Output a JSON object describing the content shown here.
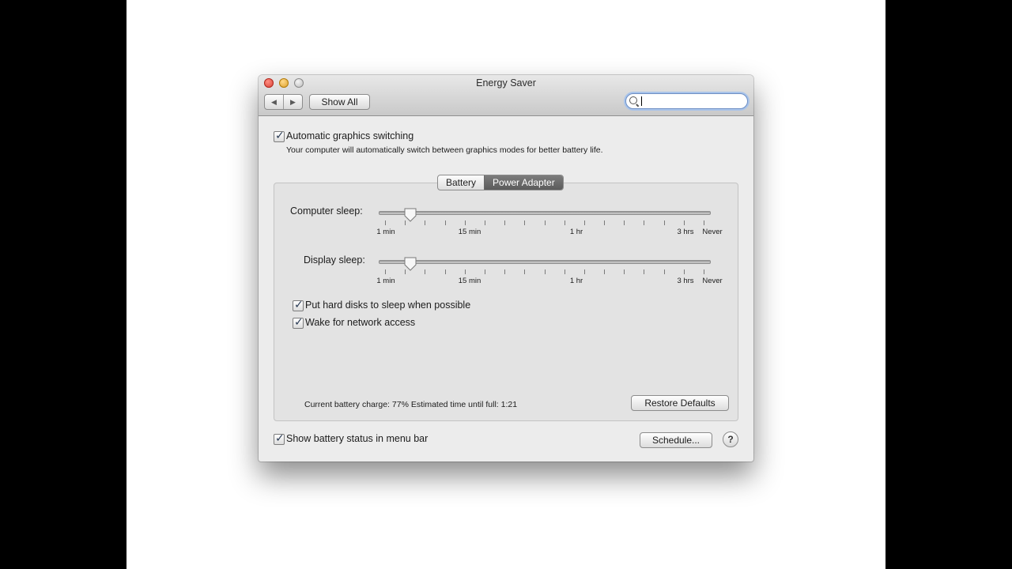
{
  "window": {
    "title": "Energy Saver"
  },
  "toolbar": {
    "back_glyph": "◀",
    "forward_glyph": "▶",
    "show_all_label": "Show All",
    "search_value": "",
    "search_icon": "magnifier-icon"
  },
  "graphics": {
    "checked": true,
    "label": "Automatic graphics switching",
    "description": "Your computer will automatically switch between graphics modes for better battery life."
  },
  "tabs": [
    {
      "label": "Battery",
      "active": false
    },
    {
      "label": "Power Adapter",
      "active": true
    }
  ],
  "computer_sleep": {
    "label": "Computer sleep:",
    "value_fraction": 0.08,
    "tick_labels": [
      "1 min",
      "15 min",
      "1 hr",
      "3 hrs",
      "Never"
    ]
  },
  "display_sleep": {
    "label": "Display sleep:",
    "value_fraction": 0.08,
    "tick_labels": [
      "1 min",
      "15 min",
      "1 hr",
      "3 hrs",
      "Never"
    ]
  },
  "options": [
    {
      "label": "Put hard disks to sleep when possible",
      "checked": true
    },
    {
      "label": "Wake for network access",
      "checked": true
    }
  ],
  "status": {
    "text": "Current battery charge: 77%  Estimated time until full: 1:21"
  },
  "buttons": {
    "restore_defaults": "Restore Defaults",
    "schedule": "Schedule...",
    "help": "?"
  },
  "footer": {
    "show_battery_checked": true,
    "show_battery_label": "Show battery status in menu bar"
  }
}
